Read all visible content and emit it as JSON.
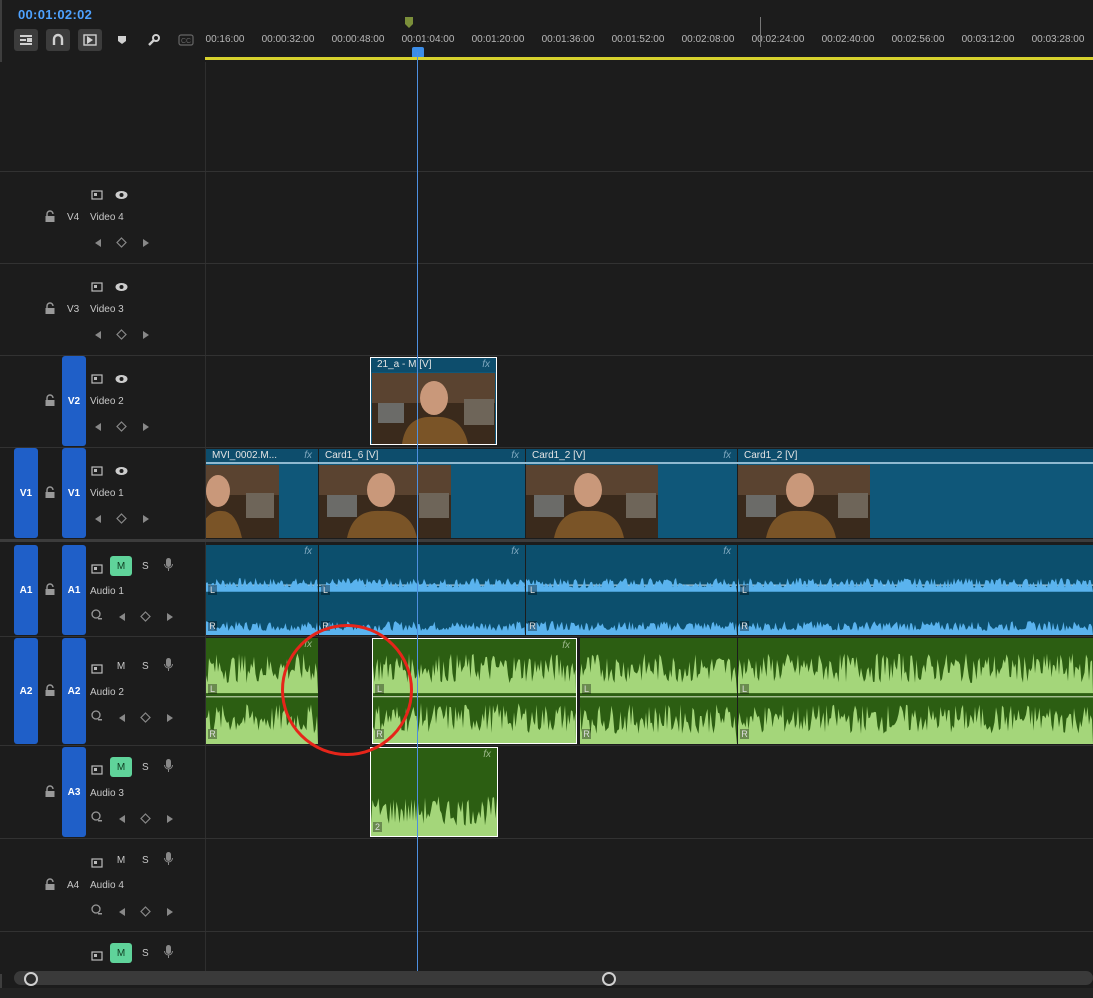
{
  "timecode": "00:01:02:02",
  "toolbar": {
    "icons": [
      "insert-nest-icon",
      "snap-magnet-icon",
      "linked-selection-icon",
      "add-marker-icon",
      "wrench-icon",
      "captions-icon"
    ]
  },
  "ruler": {
    "labels": [
      "00:16:00",
      "00:00:32:00",
      "00:00:48:00",
      "00:01:04:00",
      "00:01:20:00",
      "00:01:36:00",
      "00:01:52:00",
      "00:02:08:00",
      "00:02:24:00",
      "00:02:40:00",
      "00:02:56:00",
      "00:03:12:00",
      "00:03:28:00"
    ]
  },
  "tracks": {
    "v4": {
      "id": "V4",
      "name": "Video 4"
    },
    "v3": {
      "id": "V3",
      "name": "Video 3"
    },
    "v2": {
      "id": "V2",
      "name": "Video 2"
    },
    "v1": {
      "id": "V1",
      "name": "Video 1",
      "source": "V1"
    },
    "a1": {
      "id": "A1",
      "name": "Audio 1",
      "source": "A1",
      "mute": "M",
      "solo": "S"
    },
    "a2": {
      "id": "A2",
      "name": "Audio 2",
      "source": "A2",
      "mute": "M",
      "solo": "S"
    },
    "a3": {
      "id": "A3",
      "name": "Audio 3",
      "mute": "M",
      "solo": "S"
    },
    "a4": {
      "id": "A4",
      "name": "Audio 4",
      "mute": "M",
      "solo": "S"
    },
    "a5": {
      "mute": "M",
      "solo": "S"
    }
  },
  "clips": {
    "v2_clip": {
      "label": "21_a - M [V]",
      "fx": "fx"
    },
    "v1_clips": [
      {
        "label": "MVI_0002.M...",
        "fx": "fx"
      },
      {
        "label": "Card1_6 [V]",
        "fx": "fx"
      },
      {
        "label": "Card1_2 [V]",
        "fx": "fx"
      },
      {
        "label": "Card1_2 [V]",
        "fx": ""
      }
    ],
    "channel_left": "L",
    "channel_right": "R",
    "a3_channel": "2",
    "fx": "fx"
  },
  "colors": {
    "video_clip": "#0f5779",
    "audio1_clip": "#0c4f6d",
    "audio2_clip": "#2c5e12",
    "waveform_blue": "#5ab3ee",
    "waveform_green": "#a4d67a",
    "playhead": "#4d8fe0",
    "highlight_circle": "#e6251a",
    "track_target": "#1f5fc8",
    "mute_on": "#5fd39a",
    "timecode": "#4ea2ff"
  }
}
